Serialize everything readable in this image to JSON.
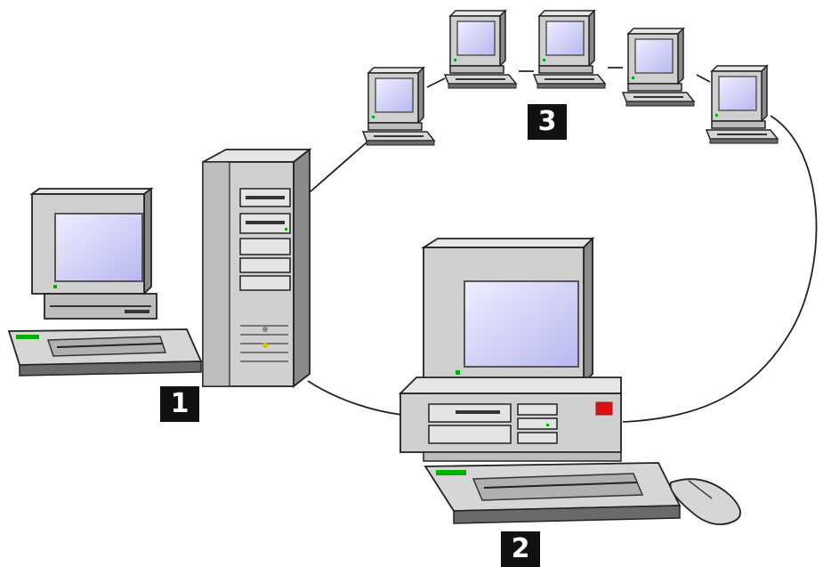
{
  "labels": {
    "one": "1",
    "two": "2",
    "three": "3"
  },
  "nodes": {
    "workstation_1": "desktop-computer-with-keyboard",
    "server": "tower-server",
    "workstation_2": "desktop-computer-with-keyboard-and-mouse",
    "network_3_terminals": [
      "terminal",
      "terminal",
      "terminal",
      "terminal",
      "terminal"
    ]
  },
  "colors": {
    "case": "#c8c8c8",
    "case_dark": "#7c7c7c",
    "screen": "#c8c8f8",
    "screen_glow": "#e8e8ff",
    "led_green": "#00b000",
    "led_red": "#e01010",
    "label_bg": "#111111",
    "label_text": "#ffffff",
    "cable": "#222222"
  }
}
